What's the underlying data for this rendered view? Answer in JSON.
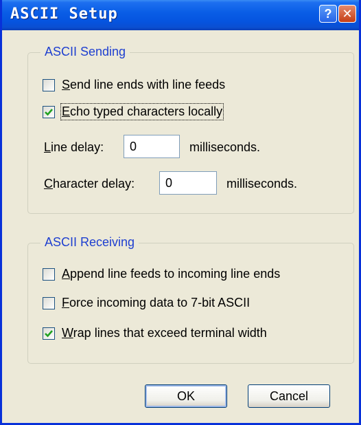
{
  "window": {
    "title": "ASCII Setup"
  },
  "titlebar": {
    "help_glyph": "?",
    "close_glyph": "✕"
  },
  "sending": {
    "legend": "ASCII Sending",
    "send_line_ends": {
      "mnemonic": "S",
      "rest": "end line ends with line feeds",
      "checked": false
    },
    "echo_typed": {
      "mnemonic": "E",
      "rest": "cho typed characters locally",
      "checked": true
    },
    "line_delay": {
      "mnemonic": "L",
      "rest": "ine delay:",
      "value": "0",
      "unit": "milliseconds."
    },
    "char_delay": {
      "mnemonic": "C",
      "rest": "haracter delay:",
      "value": "0",
      "unit": "milliseconds."
    }
  },
  "receiving": {
    "legend": "ASCII Receiving",
    "append_line_feeds": {
      "mnemonic": "A",
      "rest": "ppend line feeds to incoming line ends",
      "checked": false
    },
    "force_7bit": {
      "mnemonic": "F",
      "rest": "orce incoming data to 7-bit ASCII",
      "checked": false
    },
    "wrap_lines": {
      "mnemonic": "W",
      "rest": "rap lines that exceed terminal width",
      "checked": true
    }
  },
  "buttons": {
    "ok": "OK",
    "cancel": "Cancel"
  },
  "colors": {
    "titlebar": "#0554e0",
    "legend": "#1e3fd0",
    "face": "#ece9d8",
    "check": "#21a121"
  }
}
